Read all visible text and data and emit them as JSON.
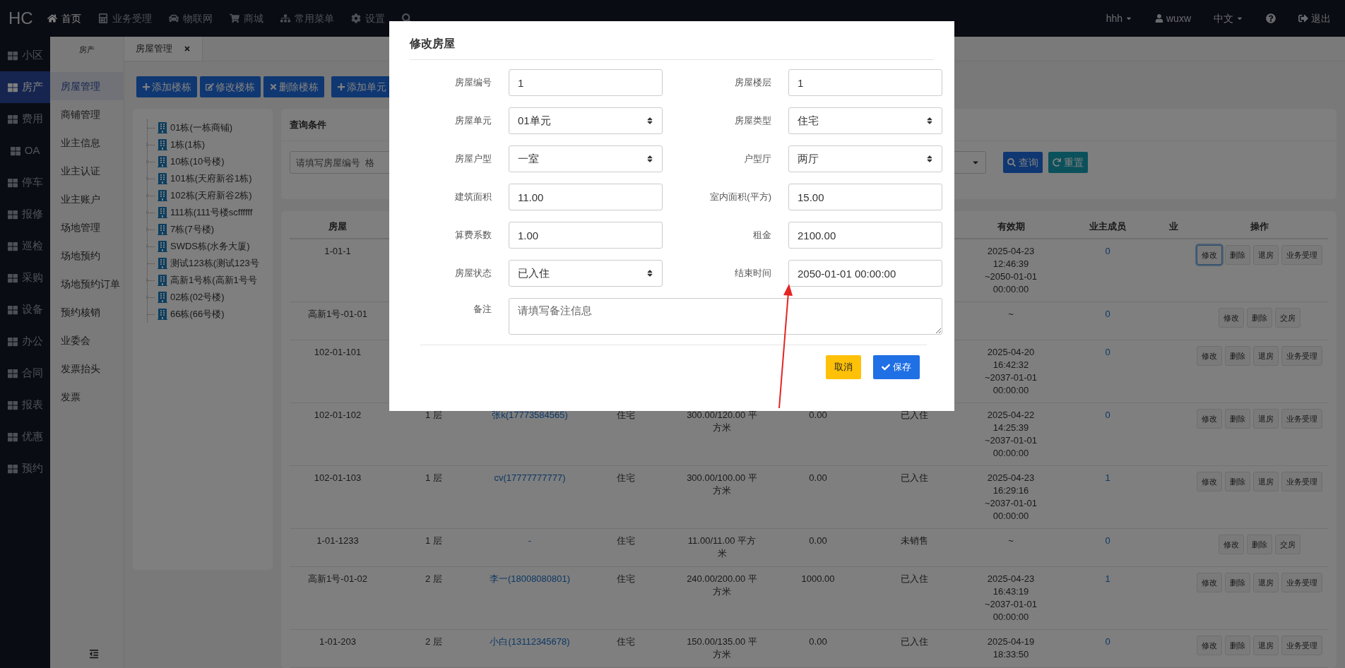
{
  "brand": "HC",
  "nav": {
    "items": [
      {
        "label": "首页",
        "selected": true
      },
      {
        "label": "业务受理",
        "selected": false
      },
      {
        "label": "物联网",
        "selected": false
      },
      {
        "label": "商城",
        "selected": false
      },
      {
        "label": "常用菜单",
        "selected": false
      },
      {
        "label": "设置",
        "selected": false
      },
      {
        "selected": false
      }
    ],
    "right": [
      {
        "kind": "dropdown",
        "label": "hhh"
      },
      {
        "kind": "user",
        "label": "wuxw"
      },
      {
        "kind": "dropdown",
        "label": "中文"
      },
      {
        "kind": "help"
      },
      {
        "kind": "logout",
        "label": "退出"
      }
    ]
  },
  "main_menu": [
    {
      "label": "小区",
      "selected": false
    },
    {
      "label": "房产",
      "selected": true
    },
    {
      "label": "费用",
      "selected": false
    },
    {
      "label": "OA",
      "selected": false
    },
    {
      "label": "停车",
      "selected": false
    },
    {
      "label": "报修",
      "selected": false
    },
    {
      "label": "巡检",
      "selected": false
    },
    {
      "label": "采购",
      "selected": false
    },
    {
      "label": "设备",
      "selected": false
    },
    {
      "label": "办公",
      "selected": false
    },
    {
      "label": "合同",
      "selected": false
    },
    {
      "label": "报表",
      "selected": false
    },
    {
      "label": "优惠",
      "selected": false
    },
    {
      "label": "预约",
      "selected": false
    }
  ],
  "sub_menu": {
    "title": "房产",
    "items": [
      {
        "label": "房屋管理",
        "selected": true
      },
      {
        "label": "商铺管理",
        "selected": false
      },
      {
        "label": "业主信息",
        "selected": false
      },
      {
        "label": "业主认证",
        "selected": false
      },
      {
        "label": "业主账户",
        "selected": false
      },
      {
        "label": "场地管理",
        "selected": false
      },
      {
        "label": "场地预约",
        "selected": false
      },
      {
        "label": "场地预约订单",
        "selected": false
      },
      {
        "label": "预约核销",
        "selected": false
      },
      {
        "label": "业委会",
        "selected": false
      },
      {
        "label": "发票抬头",
        "selected": false
      },
      {
        "label": "发票",
        "selected": false
      }
    ]
  },
  "tabs": [
    {
      "label": "房屋管理",
      "selected": true
    }
  ],
  "toolbar": [
    {
      "kind": "add",
      "label": "添加楼栋"
    },
    {
      "kind": "edit",
      "label": "修改楼栋"
    },
    {
      "kind": "delete",
      "label": "删除楼栋"
    },
    {
      "kind": "add",
      "label": "添加单元"
    }
  ],
  "tree": [
    {
      "label": "01栋(一栋商铺)",
      "kind": "leaf"
    },
    {
      "label": "1栋(1栋)",
      "kind": "branch"
    },
    {
      "label": "10栋(10号楼)",
      "kind": "branch"
    },
    {
      "label": "101栋(天府新谷1栋)",
      "kind": "branch"
    },
    {
      "label": "102栋(天府新谷2栋)",
      "kind": "branch"
    },
    {
      "label": "111栋(111号楼scffffff",
      "kind": "branch"
    },
    {
      "label": "7栋(7号楼)",
      "kind": "branch"
    },
    {
      "label": "SWDS栋(水务大厦)",
      "kind": "branch"
    },
    {
      "label": "测试123栋(测试123号",
      "kind": "leaf"
    },
    {
      "label": "高新1号栋(高新1号号",
      "kind": "branch"
    },
    {
      "label": "02栋(02号楼)",
      "kind": "branch"
    },
    {
      "label": "66栋(66号楼)",
      "kind": "leaf"
    }
  ],
  "query": {
    "title": "查询条件",
    "placeholder": "请填写房屋编号  格",
    "buttons": [
      {
        "kind": "search",
        "label": "查询"
      },
      {
        "kind": "reset",
        "label": "重置"
      }
    ]
  },
  "table": {
    "columns": {
      "house": "房屋",
      "validity": "有效期",
      "members": "业主成员",
      "column_10": "业",
      "actions": "操作"
    },
    "rows": [
      {
        "house": "1-01-1",
        "validity": "2025-04-23 12:46:39 ~2050-01-01 00:00:00",
        "members": "0",
        "actions": [
          {
            "label": "修改",
            "focused": true
          },
          {
            "label": "删除",
            "focused": false
          },
          {
            "label": "退房",
            "focused": false
          },
          {
            "label": "业务受理",
            "focused": false
          }
        ]
      },
      {
        "house": "高新1号-01-01",
        "validity": "~",
        "members": "0",
        "actions": [
          {
            "label": "修改",
            "focused": false
          },
          {
            "label": "删除",
            "focused": false
          },
          {
            "label": "交房",
            "focused": false
          }
        ]
      },
      {
        "house": "102-01-101",
        "validity": "2025-04-20 16:42:32 ~2037-01-01 00:00:00",
        "members": "0",
        "actions": [
          {
            "label": "修改",
            "focused": false
          },
          {
            "label": "删除",
            "focused": false
          },
          {
            "label": "退房",
            "focused": false
          },
          {
            "label": "业务受理",
            "focused": false
          }
        ]
      },
      {
        "house": "102-01-102",
        "floor": "1 层",
        "owner": "张k(17773584565)",
        "type": "住宅",
        "area": "300.00/120.00 平方米",
        "rent": "0.00",
        "status": "已入住",
        "validity": "2025-04-22 14:25:39 ~2037-01-01 00:00:00",
        "members": "0",
        "actions": [
          {
            "label": "修改",
            "focused": false
          },
          {
            "label": "删除",
            "focused": false
          },
          {
            "label": "退房",
            "focused": false
          },
          {
            "label": "业务受理",
            "focused": false
          }
        ]
      },
      {
        "house": "102-01-103",
        "floor": "1 层",
        "owner": "cv(17777777777)",
        "type": "住宅",
        "area": "300.00/100.00 平方米",
        "rent": "0.00",
        "status": "已入住",
        "validity": "2025-04-23 16:29:16 ~2037-01-01 00:00:00",
        "members": "1",
        "actions": [
          {
            "label": "修改",
            "focused": false
          },
          {
            "label": "删除",
            "focused": false
          },
          {
            "label": "退房",
            "focused": false
          },
          {
            "label": "业务受理",
            "focused": false
          }
        ]
      },
      {
        "house": "1-01-1233",
        "floor": "1 层",
        "owner": "-",
        "type": "住宅",
        "area": "11.00/11.00 平方米",
        "rent": "0.00",
        "status": "未销售",
        "validity": "~",
        "members": "0",
        "actions": [
          {
            "label": "修改",
            "focused": false
          },
          {
            "label": "删除",
            "focused": false
          },
          {
            "label": "交房",
            "focused": false
          }
        ]
      },
      {
        "house": "高新1号-01-02",
        "floor": "2 层",
        "owner": "李一(18008080801)",
        "type": "住宅",
        "area": "240.00/200.00 平方米",
        "rent": "1000.00",
        "status": "已入住",
        "validity": "2025-04-23 16:43:19 ~2037-01-01 00:00:00",
        "members": "1",
        "actions": [
          {
            "label": "修改",
            "focused": false
          },
          {
            "label": "删除",
            "focused": false
          },
          {
            "label": "退房",
            "focused": false
          },
          {
            "label": "业务受理",
            "focused": false
          }
        ]
      },
      {
        "house": "1-01-203",
        "floor": "2 层",
        "owner": "小白(13112345678)",
        "type": "住宅",
        "area": "150.00/135.00 平方米",
        "rent": "0.00",
        "status": "已入住",
        "validity": "2025-04-19 18:33:50",
        "members": "0",
        "actions": [
          {
            "label": "修改",
            "focused": false
          },
          {
            "label": "删除",
            "focused": false
          },
          {
            "label": "退房",
            "focused": false
          },
          {
            "label": "业务受理",
            "focused": false
          }
        ]
      }
    ]
  },
  "dialog": {
    "title": "修改房屋",
    "fields": [
      {
        "label": "房屋编号",
        "kind": "input",
        "value": "1"
      },
      {
        "label": "房屋楼层",
        "kind": "input",
        "value": "1"
      },
      {
        "label": "房屋单元",
        "kind": "select",
        "value": "01单元"
      },
      {
        "label": "房屋类型",
        "kind": "select",
        "value": "住宅"
      },
      {
        "label": "房屋户型",
        "kind": "select",
        "value": "一室"
      },
      {
        "label": "户型厅",
        "kind": "select",
        "value": "两厅"
      },
      {
        "label": "建筑面积",
        "kind": "input",
        "value": "11.00"
      },
      {
        "label": "室内面积(平方)",
        "kind": "input",
        "value": "15.00"
      },
      {
        "label": "算费系数",
        "kind": "input",
        "value": "1.00"
      },
      {
        "label": "租金",
        "kind": "input",
        "value": "2100.00"
      },
      {
        "label": "房屋状态",
        "kind": "select",
        "value": "已入住"
      },
      {
        "label": "结束时间",
        "kind": "input",
        "value": "2050-01-01 00:00:00"
      },
      {
        "label": "备注",
        "kind": "textarea",
        "placeholder": "请填写备注信息"
      }
    ],
    "buttons": [
      {
        "kind": "cancel",
        "label": "取消"
      },
      {
        "kind": "save",
        "label": "保存"
      }
    ]
  }
}
